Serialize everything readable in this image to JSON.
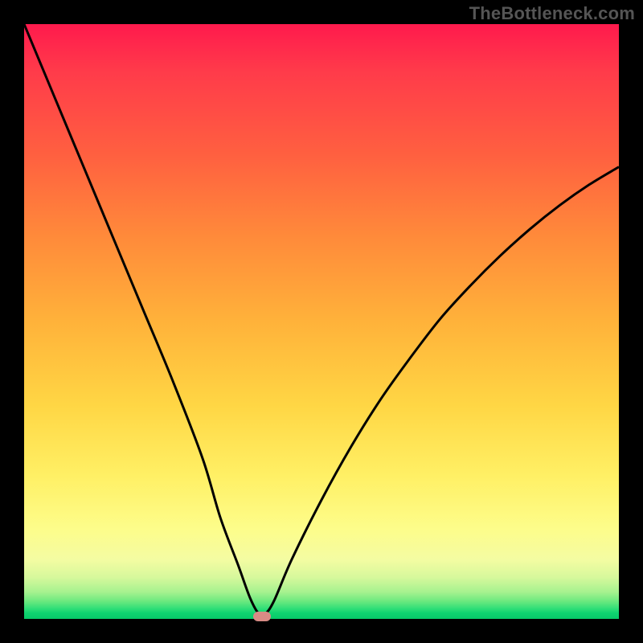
{
  "watermark": "TheBottleneck.com",
  "chart_data": {
    "type": "line",
    "title": "",
    "xlabel": "",
    "ylabel": "",
    "xlim": [
      0,
      100
    ],
    "ylim": [
      0,
      100
    ],
    "x": [
      0,
      5,
      10,
      15,
      20,
      25,
      30,
      33,
      36,
      38,
      39.5,
      40.5,
      42,
      45,
      50,
      55,
      60,
      65,
      70,
      75,
      80,
      85,
      90,
      95,
      100
    ],
    "values": [
      100,
      88,
      76,
      64,
      52,
      40,
      27,
      17,
      9,
      3.5,
      0.8,
      0.8,
      3,
      10,
      20,
      29,
      37,
      44,
      50.5,
      56,
      61,
      65.5,
      69.5,
      73,
      76
    ],
    "series": [
      {
        "name": "bottleneck-curve",
        "x_ref": "x",
        "y_ref": "values"
      }
    ],
    "marker": {
      "x": 40,
      "y": 0.4
    },
    "background": "heatmap-gradient-red-yellow-green"
  },
  "colors": {
    "curve": "#000000",
    "marker": "#d88b85"
  }
}
